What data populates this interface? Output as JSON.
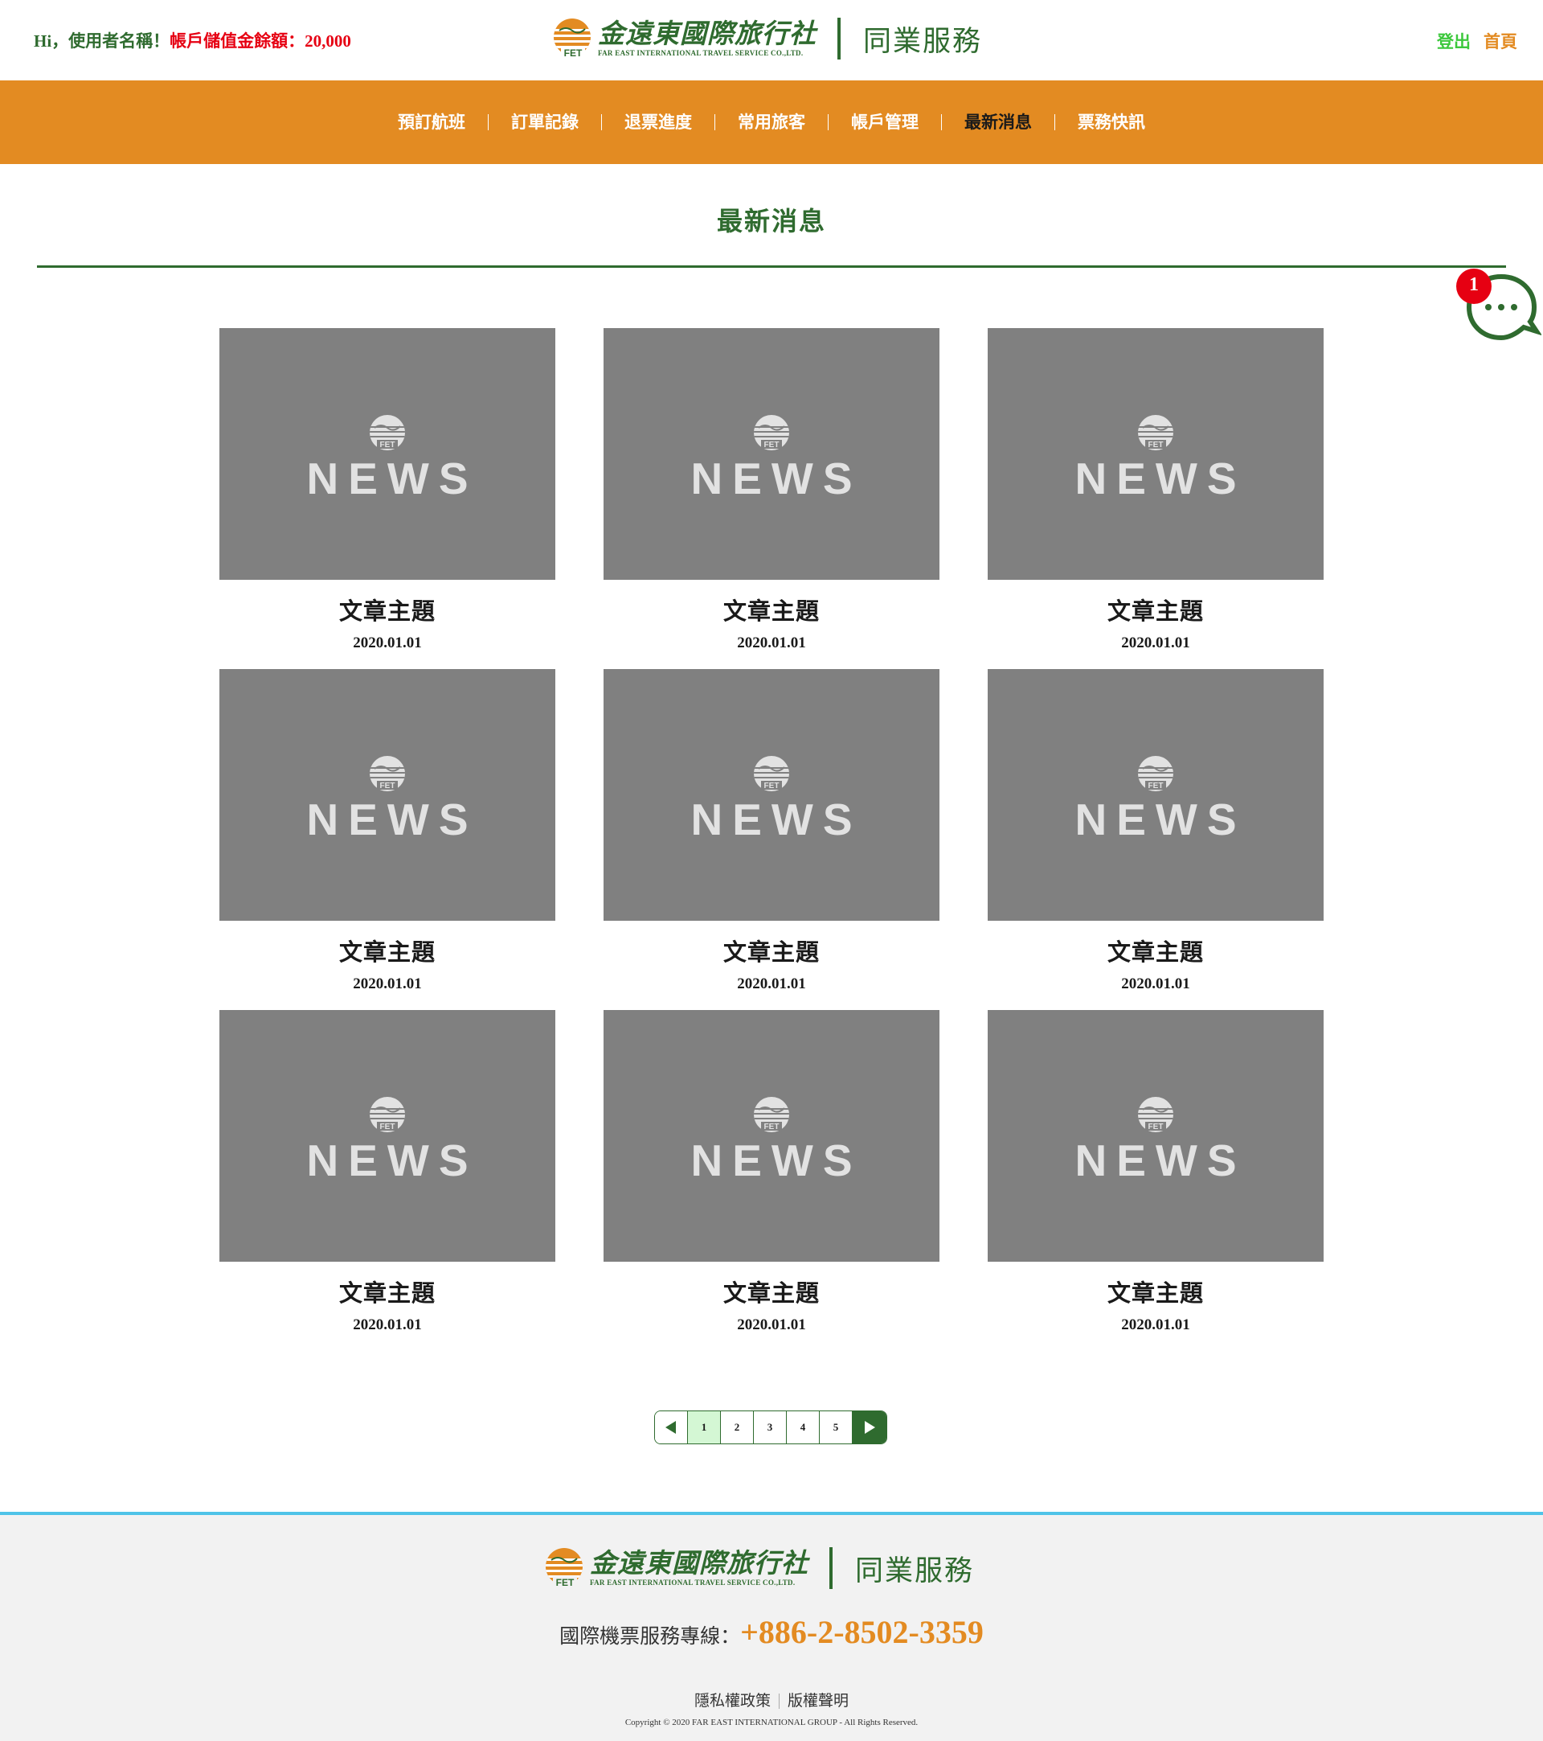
{
  "header": {
    "greeting_prefix": "Hi，使用者名稱！",
    "balance_label": "帳戶儲值金餘額：20,000",
    "logo_cn": "金遠東國際旅行社",
    "logo_en": "FAR EAST INTERNATIONAL TRAVEL SERVICE CO.,LTD.",
    "logo_mark_text": "FET",
    "service_title": "同業服務",
    "logout_label": "登出",
    "home_label": "首頁"
  },
  "nav": {
    "items": [
      {
        "label": "預訂航班"
      },
      {
        "label": "訂單記錄"
      },
      {
        "label": "退票進度"
      },
      {
        "label": "常用旅客"
      },
      {
        "label": "帳戶管理"
      },
      {
        "label": "最新消息"
      },
      {
        "label": "票務快訊"
      }
    ],
    "active_index": 5
  },
  "page": {
    "title": "最新消息"
  },
  "chat": {
    "badge_count": "1",
    "icon": "chat-bubble-icon"
  },
  "news": {
    "thumb_word": "NEWS",
    "thumb_logo_text": "FET",
    "items": [
      {
        "title": "文章主題",
        "date": "2020.01.01"
      },
      {
        "title": "文章主題",
        "date": "2020.01.01"
      },
      {
        "title": "文章主題",
        "date": "2020.01.01"
      },
      {
        "title": "文章主題",
        "date": "2020.01.01"
      },
      {
        "title": "文章主題",
        "date": "2020.01.01"
      },
      {
        "title": "文章主題",
        "date": "2020.01.01"
      },
      {
        "title": "文章主題",
        "date": "2020.01.01"
      },
      {
        "title": "文章主題",
        "date": "2020.01.01"
      },
      {
        "title": "文章主題",
        "date": "2020.01.01"
      }
    ]
  },
  "pagination": {
    "pages": [
      "1",
      "2",
      "3",
      "4",
      "5"
    ],
    "current": "1",
    "prev_icon": "arrow-left-icon",
    "next_icon": "arrow-right-icon"
  },
  "footer": {
    "logo_cn": "金遠東國際旅行社",
    "logo_en": "FAR EAST INTERNATIONAL TRAVEL SERVICE CO.,LTD.",
    "logo_mark_text": "FET",
    "service_title": "同業服務",
    "hotline_label": "國際機票服務專線：",
    "hotline_number": "+886-2-8502-3359",
    "privacy_label": "隱私權政策",
    "copyright_label": "版權聲明",
    "copyright_text": "Copyright © 2020 FAR EAST INTERNATIONAL GROUP - All Rights Reserved."
  },
  "colors": {
    "brand_green": "#2f6b2f",
    "brand_orange": "#e38b22",
    "alert_red": "#e60012",
    "footer_accent": "#4fc3e8",
    "thumb_gray": "#808080"
  }
}
